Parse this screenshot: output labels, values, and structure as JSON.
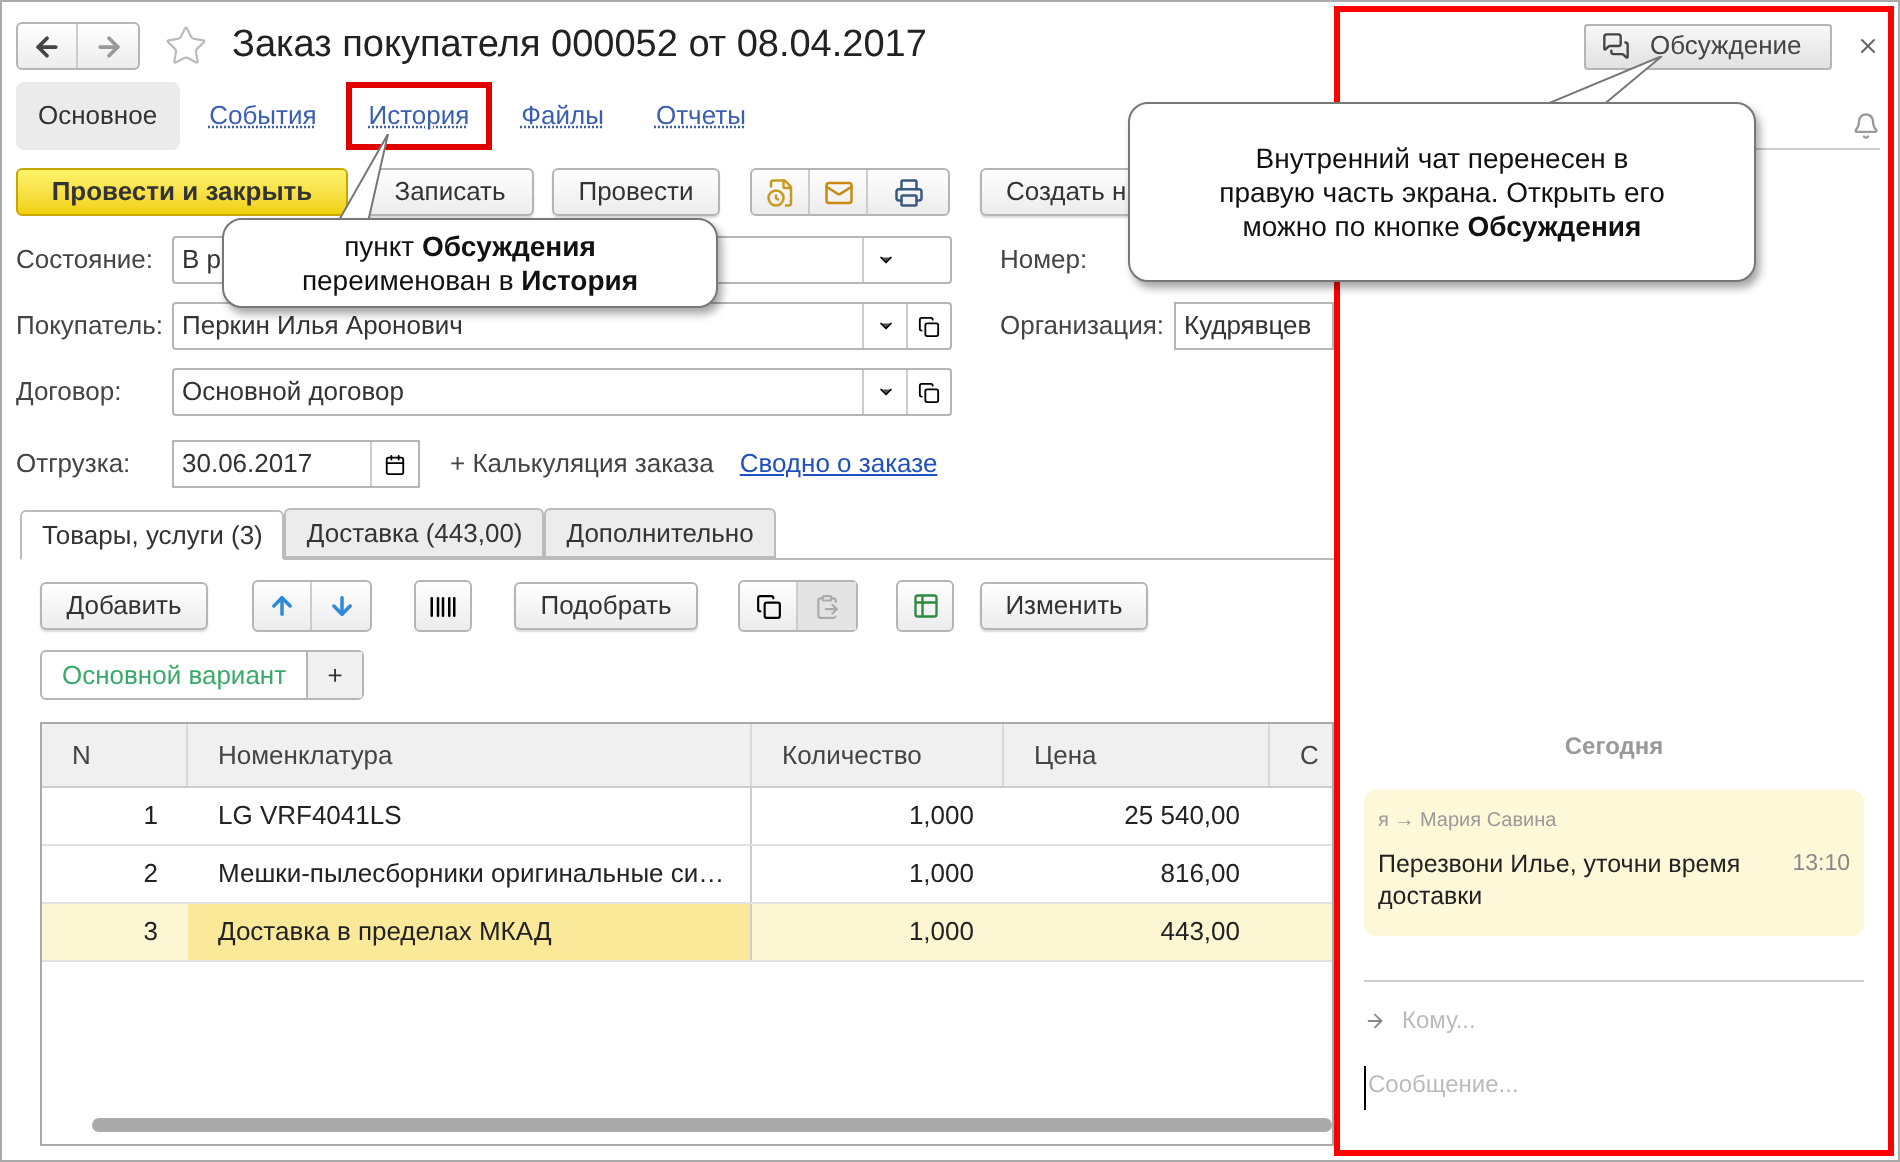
{
  "window": {
    "title": "Заказ покупателя 000052 от 08.04.2017"
  },
  "sections": [
    {
      "label": "Основное",
      "selected": true,
      "highlighted": false
    },
    {
      "label": "События",
      "selected": false,
      "highlighted": false
    },
    {
      "label": "История",
      "selected": false,
      "highlighted": true
    },
    {
      "label": "Файлы",
      "selected": false,
      "highlighted": false
    },
    {
      "label": "Отчеты",
      "selected": false,
      "highlighted": false
    }
  ],
  "commands": {
    "post_close": "Провести и закрыть",
    "save": "Записать",
    "post": "Провести",
    "create": "Создать н"
  },
  "fields": [
    {
      "label": "Состояние:",
      "value": "В р",
      "kind": "select"
    },
    {
      "label": "Покупатель:",
      "value": "Перкин Илья Аронович",
      "kind": "ref"
    },
    {
      "label": "Договор:",
      "value": "Основной договор",
      "kind": "ref"
    }
  ],
  "right_fields": [
    {
      "label": "Номер:"
    },
    {
      "label": "Организация:",
      "value": "Кудрявцев"
    }
  ],
  "shipment": {
    "label": "Отгрузка:",
    "value": "30.06.2017",
    "calc_link": "+ Калькуляция заказа",
    "summary_link": "Сводно о заказе"
  },
  "tabs": [
    {
      "label": "Товары, услуги (3)",
      "selected": true
    },
    {
      "label": "Доставка (443,00)",
      "selected": false
    },
    {
      "label": "Дополнительно",
      "selected": false
    }
  ],
  "table_toolbar": {
    "add": "Добавить",
    "pick": "Подобрать",
    "edit": "Изменить"
  },
  "variant": {
    "label": "Основной вариант",
    "add": "+"
  },
  "table": {
    "columns": [
      "N",
      "Номенклатура",
      "Количество",
      "Цена",
      "С"
    ],
    "rows": [
      {
        "cells": [
          "1",
          "LG VRF4041LS",
          "1,000",
          "25 540,00"
        ],
        "selected": false
      },
      {
        "cells": [
          "2",
          "Мешки-пылесборники оригинальные си…",
          "1,000",
          "816,00"
        ],
        "selected": false
      },
      {
        "cells": [
          "3",
          "Доставка в пределах МКАД",
          "1,000",
          "443,00"
        ],
        "selected": true
      }
    ]
  },
  "chat": {
    "button": "Обсуждение",
    "day": "Сегодня",
    "message": {
      "from": "я → Мария Савина",
      "text": "Перезвони Илье, уточни время доставки",
      "time": "13:10"
    },
    "recipient_placeholder": "Кому...",
    "message_placeholder": "Сообщение..."
  },
  "callouts": [
    {
      "text": "пункт **Обсуждения**\nпереименован в **История**"
    },
    {
      "text": "Внутренний чат перенесен в\nправую часть экрана. Открыть его\nможно по кнопке **Обсуждения**"
    }
  ]
}
